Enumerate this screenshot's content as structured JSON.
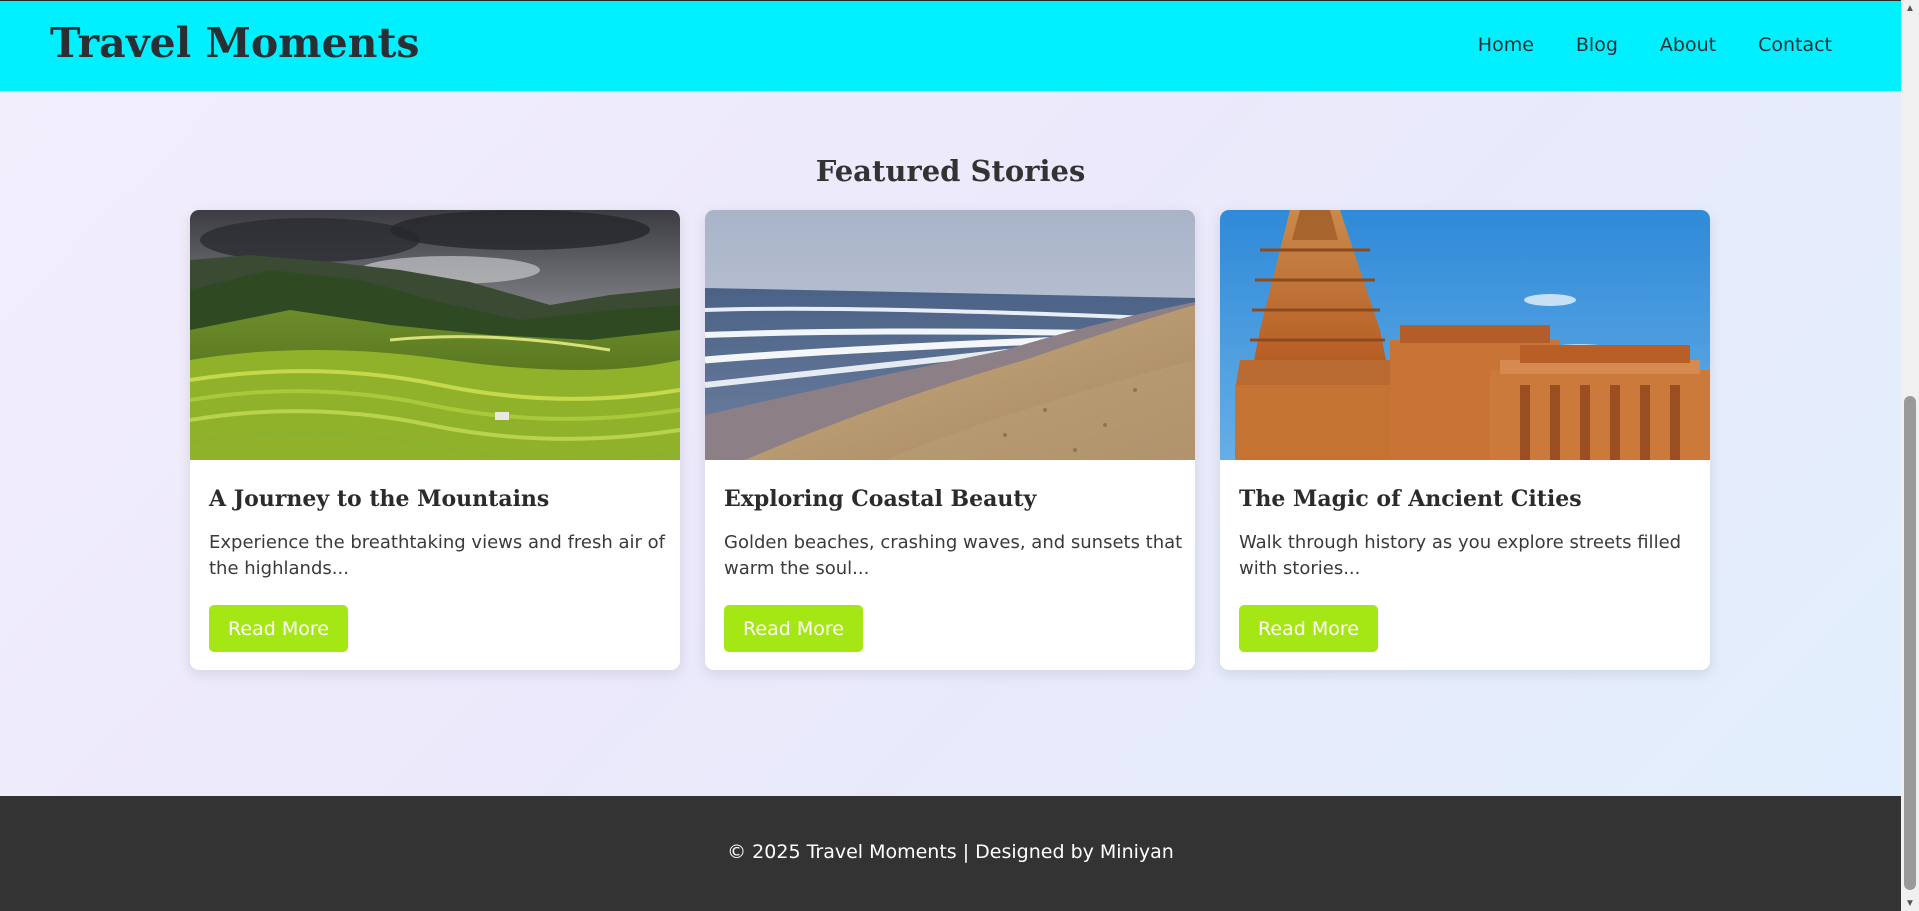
{
  "header": {
    "logo": "Travel Moments",
    "nav": [
      "Home",
      "Blog",
      "About",
      "Contact"
    ]
  },
  "main": {
    "section_title": "Featured Stories",
    "cards": [
      {
        "image": "mountain-rice-terraces",
        "title": "A Journey to the Mountains",
        "text": "Experience the breathtaking views and fresh air of the highlands...",
        "button": "Read More"
      },
      {
        "image": "beach-coastline",
        "title": "Exploring Coastal Beauty",
        "text": "Golden beaches, crashing waves, and sunsets that warm the soul...",
        "button": "Read More"
      },
      {
        "image": "ancient-temple",
        "title": "The Magic of Ancient Cities",
        "text": "Walk through history as you explore streets filled with stories...",
        "button": "Read More"
      }
    ]
  },
  "footer": {
    "text": "© 2025 Travel Moments | Designed by Miniyan"
  },
  "colors": {
    "navbar": "#00f0ff",
    "button": "#a5e715",
    "footer": "#333333"
  }
}
